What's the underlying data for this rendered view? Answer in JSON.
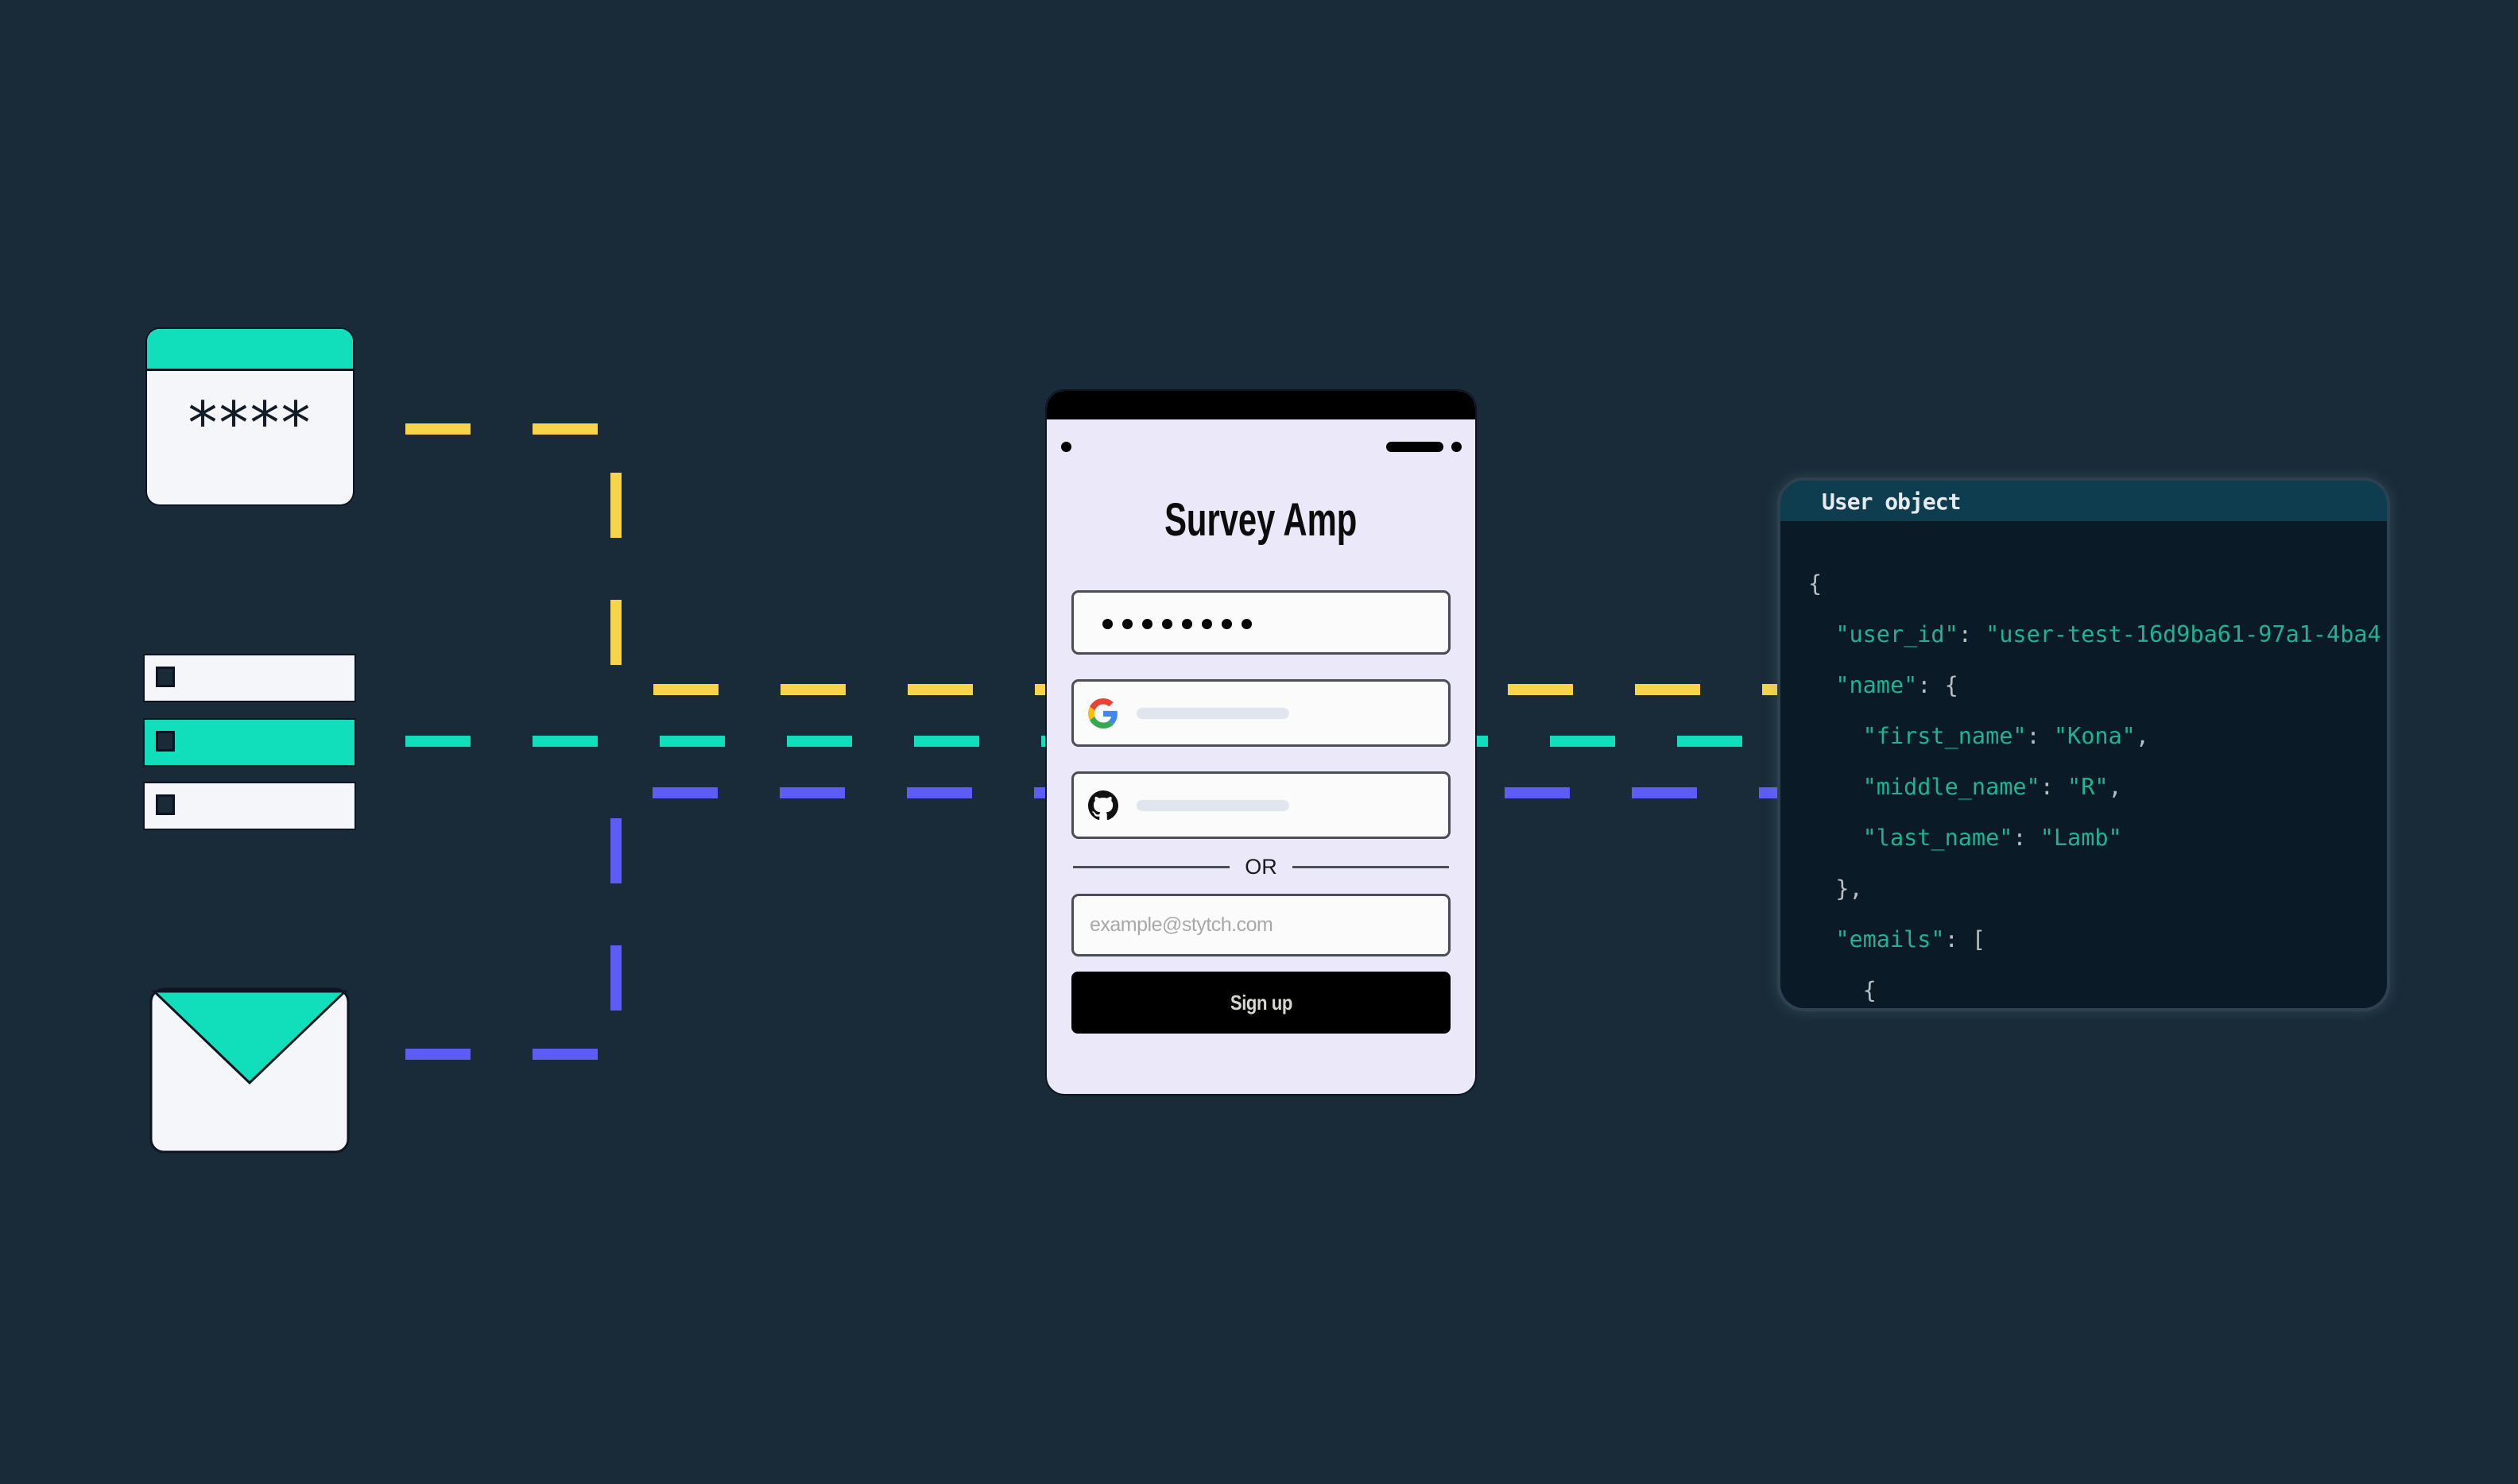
{
  "colors": {
    "background": "#192b39",
    "teal": "#11dfbc",
    "yellow": "#f7d44a",
    "purple": "#5d5cf6",
    "phone_body": "#ebe9f9",
    "code_key": "#1db394",
    "code_punct": "#b9bec3"
  },
  "auth_methods": {
    "password_icon": {
      "masked_text": "****"
    },
    "oauth_list_icon": {
      "rows": 3,
      "active_row": 2
    },
    "email_icon": {}
  },
  "phone": {
    "app_title": "Survey Amp",
    "password_field": {
      "masked_length": 8
    },
    "google_button": {
      "icon": "google-icon"
    },
    "github_button": {
      "icon": "github-icon"
    },
    "divider_label": "OR",
    "email_field": {
      "placeholder": "example@stytch.com",
      "value": ""
    },
    "signup_label": "Sign up"
  },
  "user_object": {
    "title": "User object",
    "lines": [
      {
        "indent": 0,
        "parts": [
          [
            "p",
            "{"
          ]
        ]
      },
      {
        "indent": 1,
        "parts": [
          [
            "k",
            "\"user_id\""
          ],
          [
            "p",
            ": "
          ],
          [
            "s",
            "\"user-test-16d9ba61-97a1-4ba4"
          ]
        ]
      },
      {
        "indent": 1,
        "parts": [
          [
            "k",
            "\"name\""
          ],
          [
            "p",
            ": {"
          ]
        ]
      },
      {
        "indent": 2,
        "parts": [
          [
            "k",
            "\"first_name\""
          ],
          [
            "p",
            ": "
          ],
          [
            "s",
            "\"Kona\""
          ],
          [
            "p",
            ","
          ]
        ]
      },
      {
        "indent": 2,
        "parts": [
          [
            "k",
            "\"middle_name\""
          ],
          [
            "p",
            ": "
          ],
          [
            "s",
            "\"R\""
          ],
          [
            "p",
            ","
          ]
        ]
      },
      {
        "indent": 2,
        "parts": [
          [
            "k",
            "\"last_name\""
          ],
          [
            "p",
            ": "
          ],
          [
            "s",
            "\"Lamb\""
          ]
        ]
      },
      {
        "indent": 1,
        "parts": [
          [
            "p",
            "},"
          ]
        ]
      },
      {
        "indent": 1,
        "parts": [
          [
            "k",
            "\"emails\""
          ],
          [
            "p",
            ": ["
          ]
        ]
      },
      {
        "indent": 2,
        "parts": [
          [
            "p",
            "{"
          ]
        ]
      }
    ]
  }
}
